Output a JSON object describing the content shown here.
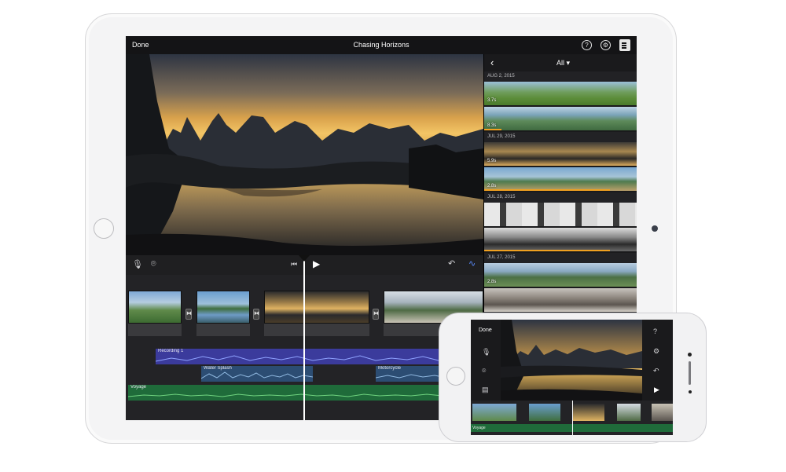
{
  "app": {
    "done_label": "Done",
    "project_title": "Chasing Horizons",
    "help_icon": "?",
    "settings_icon": "gear"
  },
  "media_browser": {
    "filter_label": "All",
    "groups": [
      {
        "date": "AUG 2, 2015",
        "clips": [
          {
            "duration": "3.7s"
          },
          {
            "duration": "8.3s"
          }
        ]
      },
      {
        "date": "JUL 29, 2015",
        "clips": [
          {
            "duration": "5.9s"
          },
          {
            "duration": "2.8s"
          }
        ]
      },
      {
        "date": "JUL 28, 2015",
        "clips": [
          {
            "duration": ""
          },
          {
            "duration": ""
          }
        ]
      },
      {
        "date": "JUL 27, 2015",
        "clips": [
          {
            "duration": "2.8s"
          },
          {
            "duration": ""
          }
        ]
      }
    ]
  },
  "timeline": {
    "audio_tracks": {
      "recording": "Recording 1",
      "splash": "Water Splash",
      "motorcycle": "Motorcycle",
      "music": "Voyage"
    }
  },
  "phone": {
    "done_label": "Done",
    "music_label": "Voyage"
  },
  "colors": {
    "accent_blue": "#5a8cff",
    "recording_lane": "#3b3b9c",
    "music_lane": "#1f6b3a",
    "effects_lane": "#2c4d73",
    "progress_orange": "#f0a020"
  }
}
